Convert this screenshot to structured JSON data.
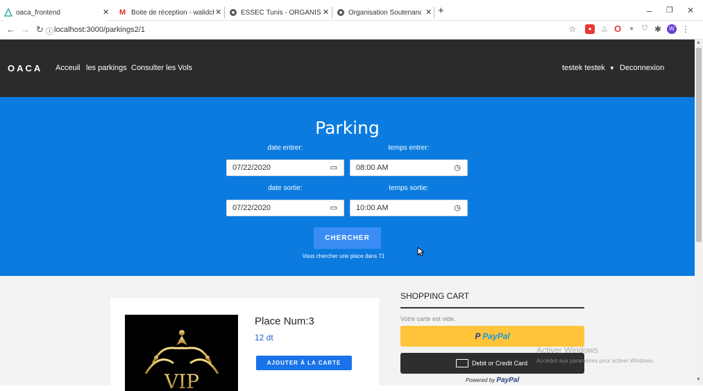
{
  "browser": {
    "tabs": [
      {
        "label": "oaca_frontend",
        "active": true
      },
      {
        "label": "Boite de réception - walidchekiri",
        "active": false
      },
      {
        "label": "ESSEC Tunis - ORGANISATION D",
        "active": false
      },
      {
        "label": "Organisation Soutenance LAIG T",
        "active": false
      }
    ],
    "new_tab_label": "+",
    "url": "localhost:3000/parkings2/1",
    "profile_initial": "W"
  },
  "navbar": {
    "brand": "OACA",
    "links": [
      "Acceuil",
      "les parkings",
      "Consulter les Vols"
    ],
    "user": "testek testek",
    "logout": "Deconnexion"
  },
  "hero": {
    "title": "Parking",
    "date_entrer_label": "date entrer:",
    "date_entrer_value": "07/22/2020",
    "temps_entrer_label": "temps entrer:",
    "temps_entrer_value": "08:00 AM",
    "date_sortie_label": "date sortie:",
    "date_sortie_value": "07/22/2020",
    "temps_sortie_label": "temps sortie:",
    "temps_sortie_value": "10:00 AM",
    "search_button": "CHERCHER",
    "hint": "Vous chercher une place dans 71"
  },
  "place": {
    "image_text": "VIP",
    "title": "Place Num:3",
    "price": "12 dt",
    "add_button": "AJOUTER À LA CARTE"
  },
  "cart": {
    "title": "SHOPPING CART",
    "empty_text": "Votre carte est vide.",
    "paypal_label": "PayPal",
    "card_label": "Debit or Credit Card",
    "powered_by": "Powered by",
    "powered_brand": "PayPal"
  },
  "watermark": {
    "line1": "Activer Windows",
    "line2": "Accédez aux paramètres pour activer Windows."
  },
  "colors": {
    "navbar": "#2b2b2b",
    "hero": "#0b7bdf",
    "button": "#3a8df5",
    "paypal": "#ffc439",
    "card_button": "#2c2e2f"
  }
}
